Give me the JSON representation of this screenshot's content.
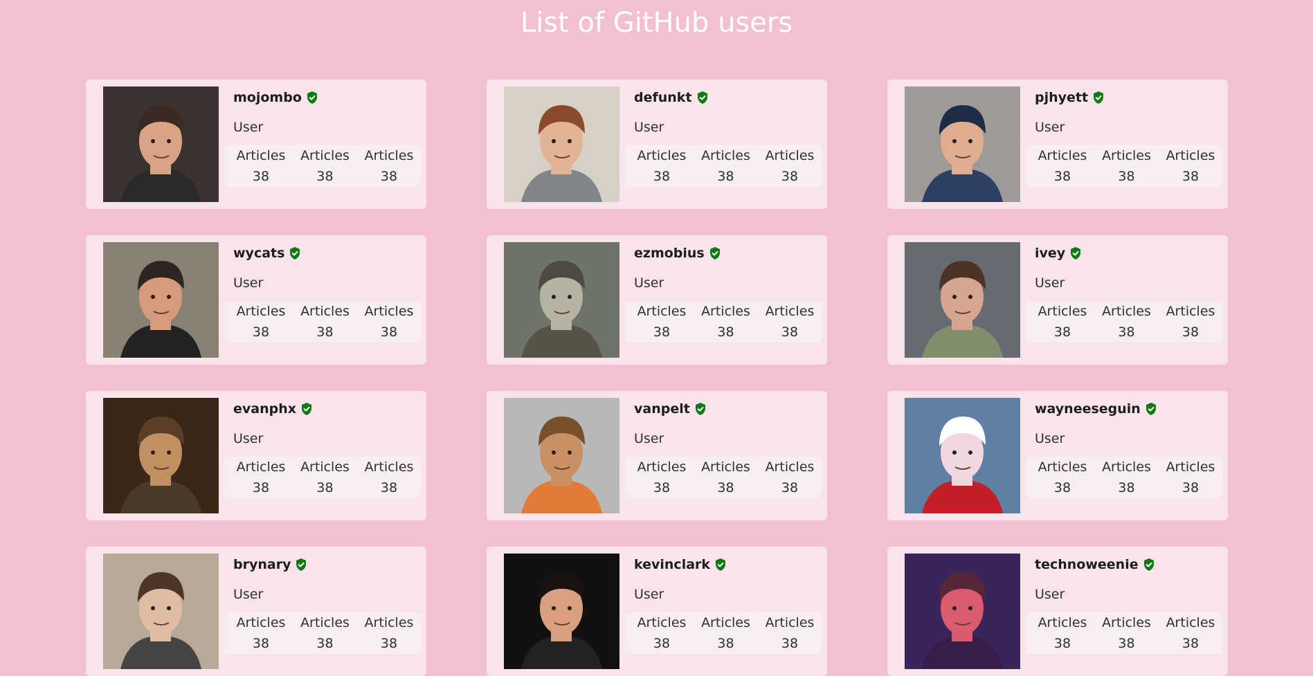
{
  "page": {
    "title": "List of GitHub users"
  },
  "colors": {
    "background": "#f2bfd3",
    "card": "#f9e4ec",
    "stats_box": "#f7eef1",
    "verified": "#0f7a13"
  },
  "users": [
    {
      "login": "mojombo",
      "type": "User",
      "stats": [
        {
          "label": "Articles",
          "value": "38"
        },
        {
          "label": "Articles",
          "value": "38"
        },
        {
          "label": "Articles",
          "value": "38"
        }
      ],
      "avatar": {
        "bg": "#3a3331",
        "face": "#d8a485",
        "hair": "#3a2a22",
        "shirt": "#2a2a2a"
      }
    },
    {
      "login": "defunkt",
      "type": "User",
      "stats": [
        {
          "label": "Articles",
          "value": "38"
        },
        {
          "label": "Articles",
          "value": "38"
        },
        {
          "label": "Articles",
          "value": "38"
        }
      ],
      "avatar": {
        "bg": "#d7d1c5",
        "face": "#e2b495",
        "hair": "#8b4a2b",
        "shirt": "#7f8588"
      }
    },
    {
      "login": "pjhyett",
      "type": "User",
      "stats": [
        {
          "label": "Articles",
          "value": "38"
        },
        {
          "label": "Articles",
          "value": "38"
        },
        {
          "label": "Articles",
          "value": "38"
        }
      ],
      "avatar": {
        "bg": "#9d9a98",
        "face": "#dfae91",
        "hair": "#1e2d45",
        "shirt": "#2d3f63"
      }
    },
    {
      "login": "wycats",
      "type": "User",
      "stats": [
        {
          "label": "Articles",
          "value": "38"
        },
        {
          "label": "Articles",
          "value": "38"
        },
        {
          "label": "Articles",
          "value": "38"
        }
      ],
      "avatar": {
        "bg": "#8a8175",
        "face": "#d69a7c",
        "hair": "#2d2522",
        "shirt": "#222222"
      }
    },
    {
      "login": "ezmobius",
      "type": "User",
      "stats": [
        {
          "label": "Articles",
          "value": "38"
        },
        {
          "label": "Articles",
          "value": "38"
        },
        {
          "label": "Articles",
          "value": "38"
        }
      ],
      "avatar": {
        "bg": "#6f7468",
        "face": "#b6b2a4",
        "hair": "#4e4a42",
        "shirt": "#565348"
      }
    },
    {
      "login": "ivey",
      "type": "User",
      "stats": [
        {
          "label": "Articles",
          "value": "38"
        },
        {
          "label": "Articles",
          "value": "38"
        },
        {
          "label": "Articles",
          "value": "38"
        }
      ],
      "avatar": {
        "bg": "#666a71",
        "face": "#d5a58d",
        "hair": "#4b3426",
        "shirt": "#7f8f6c"
      }
    },
    {
      "login": "evanphx",
      "type": "User",
      "stats": [
        {
          "label": "Articles",
          "value": "38"
        },
        {
          "label": "Articles",
          "value": "38"
        },
        {
          "label": "Articles",
          "value": "38"
        }
      ],
      "avatar": {
        "bg": "#3a2718",
        "face": "#c08f62",
        "hair": "#5a3f26",
        "shirt": "#4a3a2c"
      }
    },
    {
      "login": "vanpelt",
      "type": "User",
      "stats": [
        {
          "label": "Articles",
          "value": "38"
        },
        {
          "label": "Articles",
          "value": "38"
        },
        {
          "label": "Articles",
          "value": "38"
        }
      ],
      "avatar": {
        "bg": "#b8b8b8",
        "face": "#c99065",
        "hair": "#7a4f2c",
        "shirt": "#e27b36"
      }
    },
    {
      "login": "wayneeseguin",
      "type": "User",
      "stats": [
        {
          "label": "Articles",
          "value": "38"
        },
        {
          "label": "Articles",
          "value": "38"
        },
        {
          "label": "Articles",
          "value": "38"
        }
      ],
      "avatar": {
        "bg": "#5f7fa5",
        "face": "#f1d8e0",
        "hair": "#ffffff",
        "shirt": "#c21f28"
      }
    },
    {
      "login": "brynary",
      "type": "User",
      "stats": [
        {
          "label": "Articles",
          "value": "38"
        },
        {
          "label": "Articles",
          "value": "38"
        },
        {
          "label": "Articles",
          "value": "38"
        }
      ],
      "avatar": {
        "bg": "#b8a898",
        "face": "#e0bda2",
        "hair": "#4a3528",
        "shirt": "#444444"
      }
    },
    {
      "login": "kevinclark",
      "type": "User",
      "stats": [
        {
          "label": "Articles",
          "value": "38"
        },
        {
          "label": "Articles",
          "value": "38"
        },
        {
          "label": "Articles",
          "value": "38"
        }
      ],
      "avatar": {
        "bg": "#111111",
        "face": "#d8a07f",
        "hair": "#1a1210",
        "shirt": "#222222"
      }
    },
    {
      "login": "technoweenie",
      "type": "User",
      "stats": [
        {
          "label": "Articles",
          "value": "38"
        },
        {
          "label": "Articles",
          "value": "38"
        },
        {
          "label": "Articles",
          "value": "38"
        }
      ],
      "avatar": {
        "bg": "#3b2459",
        "face": "#d95b6d",
        "hair": "#572738",
        "shirt": "#351e48"
      }
    }
  ]
}
